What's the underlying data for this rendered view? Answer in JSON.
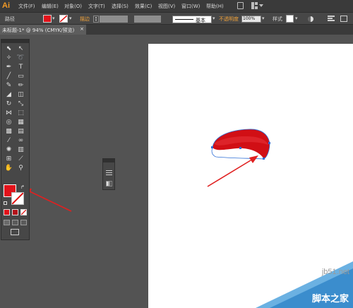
{
  "app": {
    "logo": "Ai"
  },
  "menu": [
    {
      "id": "file",
      "label": "文件(F)"
    },
    {
      "id": "edit",
      "label": "编辑(E)"
    },
    {
      "id": "object",
      "label": "对象(O)"
    },
    {
      "id": "type",
      "label": "文字(T)"
    },
    {
      "id": "select",
      "label": "选择(S)"
    },
    {
      "id": "effect",
      "label": "效果(C)"
    },
    {
      "id": "view",
      "label": "视图(V)"
    },
    {
      "id": "window",
      "label": "窗口(W)"
    },
    {
      "id": "help",
      "label": "帮助(H)"
    }
  ],
  "options": {
    "selection_label": "路径",
    "stroke_label": "描边",
    "brush_label": "基本",
    "opacity_label": "不透明度",
    "opacity_value": "100%",
    "style_label": "样式"
  },
  "document_tab": {
    "title": "未标题-1* @ 94% (CMYK/预览)",
    "close": "×"
  },
  "colors": {
    "fill": "#e2121a",
    "shape_fill": "#d10f15",
    "arrow": "#e02020",
    "selection": "#2f6fd6"
  },
  "watermark": {
    "site": "jb51.net",
    "text": "脚本之家"
  }
}
